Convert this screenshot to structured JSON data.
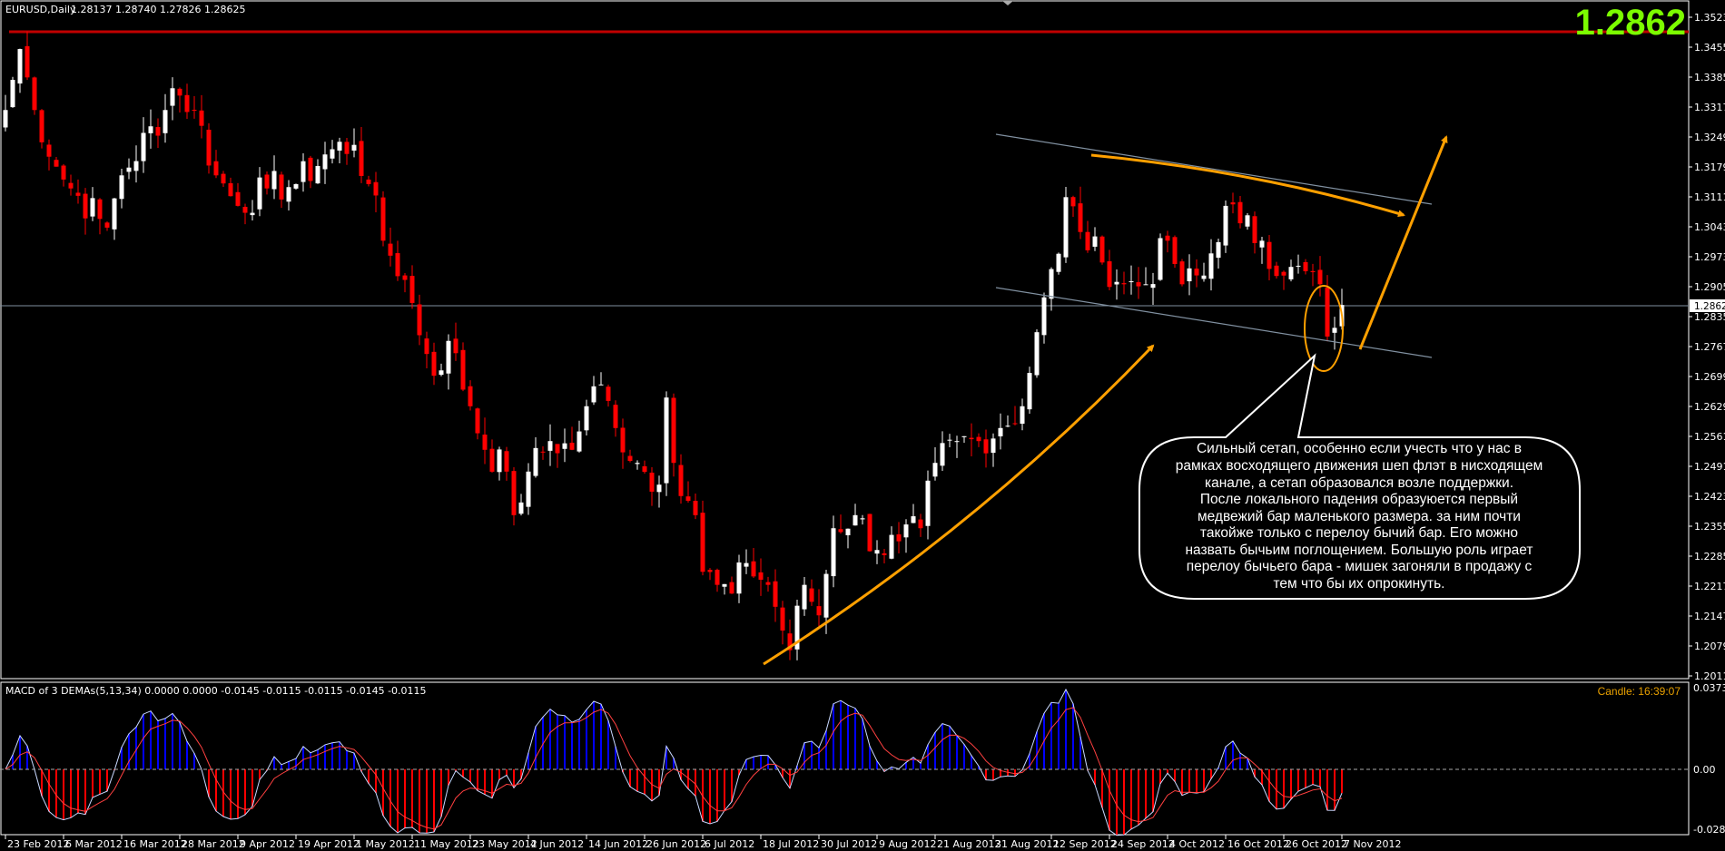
{
  "header": {
    "symbol": "EURUSD,Daily",
    "ohlc": "1.28137 1.28740 1.27826 1.28625",
    "big_price": "1.2862"
  },
  "price_axis": {
    "labels": [
      "1.35230",
      "1.34550",
      "1.33850",
      "1.33170",
      "1.32490",
      "1.31790",
      "1.31110",
      "1.30430",
      "1.29730",
      "1.29050",
      "1.28350",
      "1.27670",
      "1.26990",
      "1.26290",
      "1.25610",
      "1.24910",
      "1.24230",
      "1.23550",
      "1.22850",
      "1.22170",
      "1.21470",
      "1.20790",
      "1.20110"
    ],
    "current_price": "1.28625"
  },
  "date_axis": [
    "23 Feb 2012",
    "6 Mar 2012",
    "16 Mar 2012",
    "28 Mar 2012",
    "9 Apr 2012",
    "19 Apr 2012",
    "1 May 2012",
    "11 May 2012",
    "23 May 2012",
    "4 Jun 2012",
    "14 Jun 2012",
    "26 Jun 2012",
    "6 Jul 2012",
    "18 Jul 2012",
    "30 Jul 2012",
    "9 Aug 2012",
    "21 Aug 2012",
    "31 Aug 2012",
    "12 Sep 2012",
    "24 Sep 2012",
    "4 Oct 2012",
    "16 Oct 2012",
    "26 Oct 2012",
    "7 Nov 2012"
  ],
  "indicator": {
    "label": "MACD of 3 DEMAs(5,13,34) 0.0000 0.0000 -0.0145 -0.0115 -0.0115 -0.0145 -0.0115",
    "axis_top": "0.0373",
    "axis_zero": "0.00",
    "axis_bottom": "-0.0282",
    "candle_timer": "Candle:  16:39:07"
  },
  "annotation": {
    "text": "Сильный сетап, особенно если учесть что у нас в\nрамках восходящего движения шеп флэт в нисходящем\nканале, а сетап образовался возле поддержки.\nПосле локального падения образуюется первый\nмедвежий бар маленького размера. за ним почти\nтакойже только с перелоу бычий бар.  Его можно\nназвать бычьим поглощением. Большую роль играет\nперелоу бычьего бара - мишек загоняли в продажу с\nтем что бы их опрокинуть."
  },
  "colors": {
    "bull": "#ffffff",
    "bear": "#ff0000",
    "accent": "#ffa000",
    "big_price": "#7cfc00",
    "level": "#c00000",
    "grid": "#8090a0"
  },
  "chart_data": {
    "type": "candlestick",
    "title": "EURUSD,Daily",
    "bars": 185,
    "ylim": [
      1.2011,
      1.3523
    ],
    "resistance_level": 1.349,
    "current_price": 1.28625,
    "close_keypoints": [
      [
        0,
        1.331
      ],
      [
        2,
        1.345
      ],
      [
        4,
        1.331
      ],
      [
        7,
        1.318
      ],
      [
        9,
        1.313
      ],
      [
        13,
        1.306
      ],
      [
        14,
        1.304
      ],
      [
        16,
        1.316
      ],
      [
        22,
        1.331
      ],
      [
        23,
        1.336
      ],
      [
        26,
        1.331
      ],
      [
        29,
        1.316
      ],
      [
        32,
        1.309
      ],
      [
        36,
        1.313
      ],
      [
        40,
        1.314
      ],
      [
        45,
        1.322
      ],
      [
        48,
        1.323
      ],
      [
        50,
        1.314
      ],
      [
        52,
        1.301
      ],
      [
        55,
        1.292
      ],
      [
        58,
        1.275
      ],
      [
        59,
        1.27
      ],
      [
        61,
        1.278
      ],
      [
        64,
        1.263
      ],
      [
        66,
        1.253
      ],
      [
        69,
        1.248
      ],
      [
        70,
        1.238
      ],
      [
        72,
        1.248
      ],
      [
        75,
        1.255
      ],
      [
        78,
        1.253
      ],
      [
        80,
        1.263
      ],
      [
        82,
        1.268
      ],
      [
        84,
        1.258
      ],
      [
        87,
        1.25
      ],
      [
        90,
        1.245
      ],
      [
        91,
        1.265
      ],
      [
        92,
        1.25
      ],
      [
        95,
        1.238
      ],
      [
        96,
        1.225
      ],
      [
        98,
        1.222
      ],
      [
        100,
        1.22
      ],
      [
        102,
        1.227
      ],
      [
        105,
        1.222
      ],
      [
        108,
        1.207
      ],
      [
        110,
        1.222
      ],
      [
        112,
        1.215
      ],
      [
        114,
        1.235
      ],
      [
        117,
        1.238
      ],
      [
        120,
        1.23
      ],
      [
        123,
        1.232
      ],
      [
        126,
        1.235
      ],
      [
        128,
        1.25
      ],
      [
        131,
        1.255
      ],
      [
        134,
        1.255
      ],
      [
        137,
        1.258
      ],
      [
        140,
        1.263
      ],
      [
        142,
        1.28
      ],
      [
        143,
        1.288
      ],
      [
        145,
        1.298
      ],
      [
        146,
        1.311
      ],
      [
        148,
        1.303
      ],
      [
        151,
        1.296
      ],
      [
        154,
        1.291
      ],
      [
        157,
        1.291
      ],
      [
        160,
        1.301
      ],
      [
        162,
        1.291
      ],
      [
        165,
        1.293
      ],
      [
        168,
        1.309
      ],
      [
        170,
        1.305
      ],
      [
        173,
        1.301
      ],
      [
        176,
        1.293
      ],
      [
        179,
        1.294
      ],
      [
        181,
        1.291
      ],
      [
        182,
        1.279
      ],
      [
        183,
        1.281
      ],
      [
        184,
        1.28625
      ]
    ]
  }
}
